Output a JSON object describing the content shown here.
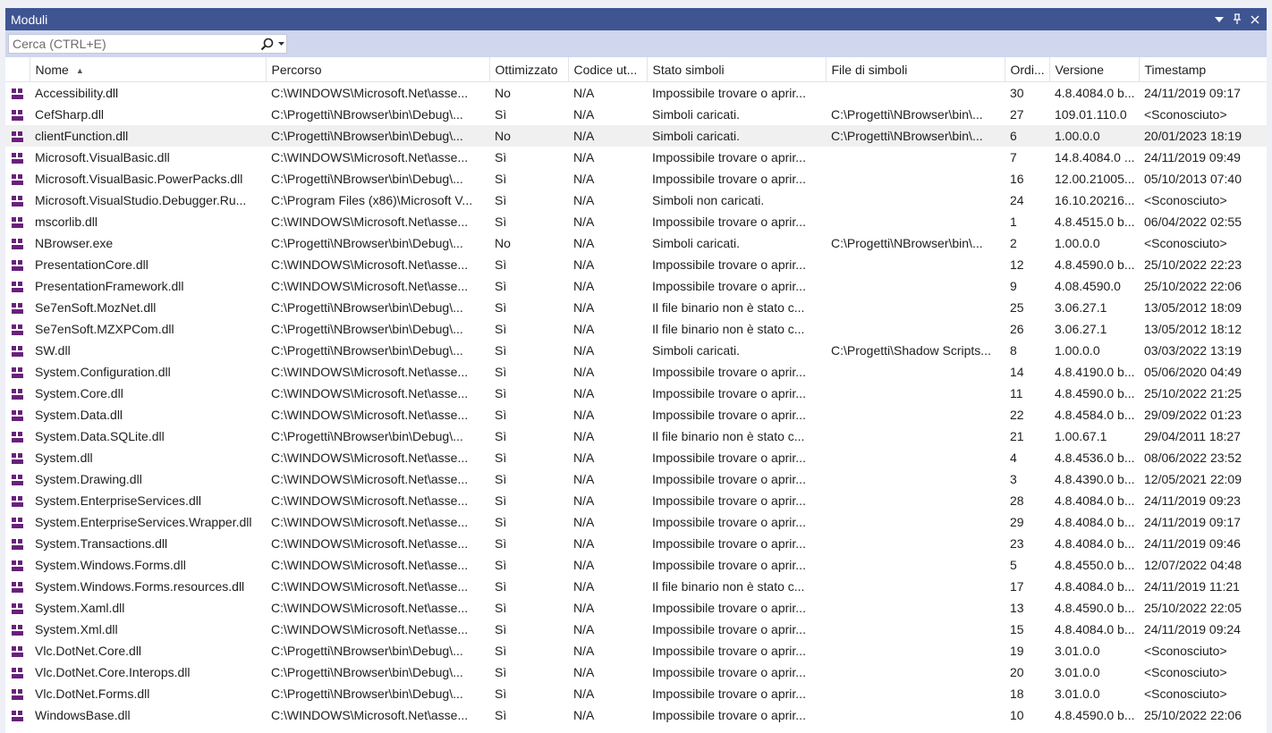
{
  "window": {
    "title": "Moduli"
  },
  "search": {
    "placeholder": "Cerca (CTRL+E)"
  },
  "columns": [
    "Nome",
    "Percorso",
    "Ottimizzato",
    "Codice ut...",
    "Stato simboli",
    "File di simboli",
    "Ordi...",
    "Versione",
    "Timestamp"
  ],
  "rows": [
    [
      "Accessibility.dll",
      "C:\\WINDOWS\\Microsoft.Net\\asse...",
      "No",
      "N/A",
      "Impossibile trovare o aprir...",
      "",
      "30",
      "4.8.4084.0 b...",
      "24/11/2019 09:17"
    ],
    [
      "CefSharp.dll",
      "C:\\Progetti\\NBrowser\\bin\\Debug\\...",
      "Sì",
      "N/A",
      "Simboli caricati.",
      "C:\\Progetti\\NBrowser\\bin\\...",
      "27",
      "109.01.110.0",
      "<Sconosciuto>"
    ],
    [
      "clientFunction.dll",
      "C:\\Progetti\\NBrowser\\bin\\Debug\\...",
      "No",
      "N/A",
      "Simboli caricati.",
      "C:\\Progetti\\NBrowser\\bin\\...",
      "6",
      "1.00.0.0",
      "20/01/2023 18:19"
    ],
    [
      "Microsoft.VisualBasic.dll",
      "C:\\WINDOWS\\Microsoft.Net\\asse...",
      "Sì",
      "N/A",
      "Impossibile trovare o aprir...",
      "",
      "7",
      "14.8.4084.0 ...",
      "24/11/2019 09:49"
    ],
    [
      "Microsoft.VisualBasic.PowerPacks.dll",
      "C:\\Progetti\\NBrowser\\bin\\Debug\\...",
      "Sì",
      "N/A",
      "Impossibile trovare o aprir...",
      "",
      "16",
      "12.00.21005...",
      "05/10/2013 07:40"
    ],
    [
      "Microsoft.VisualStudio.Debugger.Ru...",
      "C:\\Program Files (x86)\\Microsoft V...",
      "Sì",
      "N/A",
      "Simboli non caricati.",
      "",
      "24",
      "16.10.20216...",
      "<Sconosciuto>"
    ],
    [
      "mscorlib.dll",
      "C:\\WINDOWS\\Microsoft.Net\\asse...",
      "Sì",
      "N/A",
      "Impossibile trovare o aprir...",
      "",
      "1",
      "4.8.4515.0 b...",
      "06/04/2022 02:55"
    ],
    [
      "NBrowser.exe",
      "C:\\Progetti\\NBrowser\\bin\\Debug\\...",
      "No",
      "N/A",
      "Simboli caricati.",
      "C:\\Progetti\\NBrowser\\bin\\...",
      "2",
      "1.00.0.0",
      "<Sconosciuto>"
    ],
    [
      "PresentationCore.dll",
      "C:\\WINDOWS\\Microsoft.Net\\asse...",
      "Sì",
      "N/A",
      "Impossibile trovare o aprir...",
      "",
      "12",
      "4.8.4590.0 b...",
      "25/10/2022 22:23"
    ],
    [
      "PresentationFramework.dll",
      "C:\\WINDOWS\\Microsoft.Net\\asse...",
      "Sì",
      "N/A",
      "Impossibile trovare o aprir...",
      "",
      "9",
      "4.08.4590.0",
      "25/10/2022 22:06"
    ],
    [
      "Se7enSoft.MozNet.dll",
      "C:\\Progetti\\NBrowser\\bin\\Debug\\...",
      "Sì",
      "N/A",
      "Il file binario non è stato c...",
      "",
      "25",
      "3.06.27.1",
      "13/05/2012 18:09"
    ],
    [
      "Se7enSoft.MZXPCom.dll",
      "C:\\Progetti\\NBrowser\\bin\\Debug\\...",
      "Sì",
      "N/A",
      "Il file binario non è stato c...",
      "",
      "26",
      "3.06.27.1",
      "13/05/2012 18:12"
    ],
    [
      "SW.dll",
      "C:\\Progetti\\NBrowser\\bin\\Debug\\...",
      "Sì",
      "N/A",
      "Simboli caricati.",
      "C:\\Progetti\\Shadow Scripts...",
      "8",
      "1.00.0.0",
      "03/03/2022 13:19"
    ],
    [
      "System.Configuration.dll",
      "C:\\WINDOWS\\Microsoft.Net\\asse...",
      "Sì",
      "N/A",
      "Impossibile trovare o aprir...",
      "",
      "14",
      "4.8.4190.0 b...",
      "05/06/2020 04:49"
    ],
    [
      "System.Core.dll",
      "C:\\WINDOWS\\Microsoft.Net\\asse...",
      "Sì",
      "N/A",
      "Impossibile trovare o aprir...",
      "",
      "11",
      "4.8.4590.0 b...",
      "25/10/2022 21:25"
    ],
    [
      "System.Data.dll",
      "C:\\WINDOWS\\Microsoft.Net\\asse...",
      "Sì",
      "N/A",
      "Impossibile trovare o aprir...",
      "",
      "22",
      "4.8.4584.0 b...",
      "29/09/2022 01:23"
    ],
    [
      "System.Data.SQLite.dll",
      "C:\\Progetti\\NBrowser\\bin\\Debug\\...",
      "Sì",
      "N/A",
      "Il file binario non è stato c...",
      "",
      "21",
      "1.00.67.1",
      "29/04/2011 18:27"
    ],
    [
      "System.dll",
      "C:\\WINDOWS\\Microsoft.Net\\asse...",
      "Sì",
      "N/A",
      "Impossibile trovare o aprir...",
      "",
      "4",
      "4.8.4536.0 b...",
      "08/06/2022 23:52"
    ],
    [
      "System.Drawing.dll",
      "C:\\WINDOWS\\Microsoft.Net\\asse...",
      "Sì",
      "N/A",
      "Impossibile trovare o aprir...",
      "",
      "3",
      "4.8.4390.0 b...",
      "12/05/2021 22:09"
    ],
    [
      "System.EnterpriseServices.dll",
      "C:\\WINDOWS\\Microsoft.Net\\asse...",
      "Sì",
      "N/A",
      "Impossibile trovare o aprir...",
      "",
      "28",
      "4.8.4084.0 b...",
      "24/11/2019 09:23"
    ],
    [
      "System.EnterpriseServices.Wrapper.dll",
      "C:\\WINDOWS\\Microsoft.Net\\asse...",
      "Sì",
      "N/A",
      "Impossibile trovare o aprir...",
      "",
      "29",
      "4.8.4084.0 b...",
      "24/11/2019 09:17"
    ],
    [
      "System.Transactions.dll",
      "C:\\WINDOWS\\Microsoft.Net\\asse...",
      "Sì",
      "N/A",
      "Impossibile trovare o aprir...",
      "",
      "23",
      "4.8.4084.0 b...",
      "24/11/2019 09:46"
    ],
    [
      "System.Windows.Forms.dll",
      "C:\\WINDOWS\\Microsoft.Net\\asse...",
      "Sì",
      "N/A",
      "Impossibile trovare o aprir...",
      "",
      "5",
      "4.8.4550.0 b...",
      "12/07/2022 04:48"
    ],
    [
      "System.Windows.Forms.resources.dll",
      "C:\\WINDOWS\\Microsoft.Net\\asse...",
      "Sì",
      "N/A",
      "Il file binario non è stato c...",
      "",
      "17",
      "4.8.4084.0 b...",
      "24/11/2019 11:21"
    ],
    [
      "System.Xaml.dll",
      "C:\\WINDOWS\\Microsoft.Net\\asse...",
      "Sì",
      "N/A",
      "Impossibile trovare o aprir...",
      "",
      "13",
      "4.8.4590.0 b...",
      "25/10/2022 22:05"
    ],
    [
      "System.Xml.dll",
      "C:\\WINDOWS\\Microsoft.Net\\asse...",
      "Sì",
      "N/A",
      "Impossibile trovare o aprir...",
      "",
      "15",
      "4.8.4084.0 b...",
      "24/11/2019 09:24"
    ],
    [
      "Vlc.DotNet.Core.dll",
      "C:\\Progetti\\NBrowser\\bin\\Debug\\...",
      "Sì",
      "N/A",
      "Impossibile trovare o aprir...",
      "",
      "19",
      "3.01.0.0",
      "<Sconosciuto>"
    ],
    [
      "Vlc.DotNet.Core.Interops.dll",
      "C:\\Progetti\\NBrowser\\bin\\Debug\\...",
      "Sì",
      "N/A",
      "Impossibile trovare o aprir...",
      "",
      "20",
      "3.01.0.0",
      "<Sconosciuto>"
    ],
    [
      "Vlc.DotNet.Forms.dll",
      "C:\\Progetti\\NBrowser\\bin\\Debug\\...",
      "Sì",
      "N/A",
      "Impossibile trovare o aprir...",
      "",
      "18",
      "3.01.0.0",
      "<Sconosciuto>"
    ],
    [
      "WindowsBase.dll",
      "C:\\WINDOWS\\Microsoft.Net\\asse...",
      "Sì",
      "N/A",
      "Impossibile trovare o aprir...",
      "",
      "10",
      "4.8.4590.0 b...",
      "25/10/2022 22:06"
    ]
  ],
  "colors": {
    "accent": "#3f5592",
    "toolbar": "#cfd6ee",
    "module_icon": "#68217a",
    "selected_row": "#f0f0f0"
  },
  "icons": {
    "titlebar": [
      "dropdown-icon",
      "pin-icon",
      "close-icon"
    ],
    "search": [
      "search-icon",
      "chevron-down-icon"
    ],
    "rows": "module-icon"
  }
}
